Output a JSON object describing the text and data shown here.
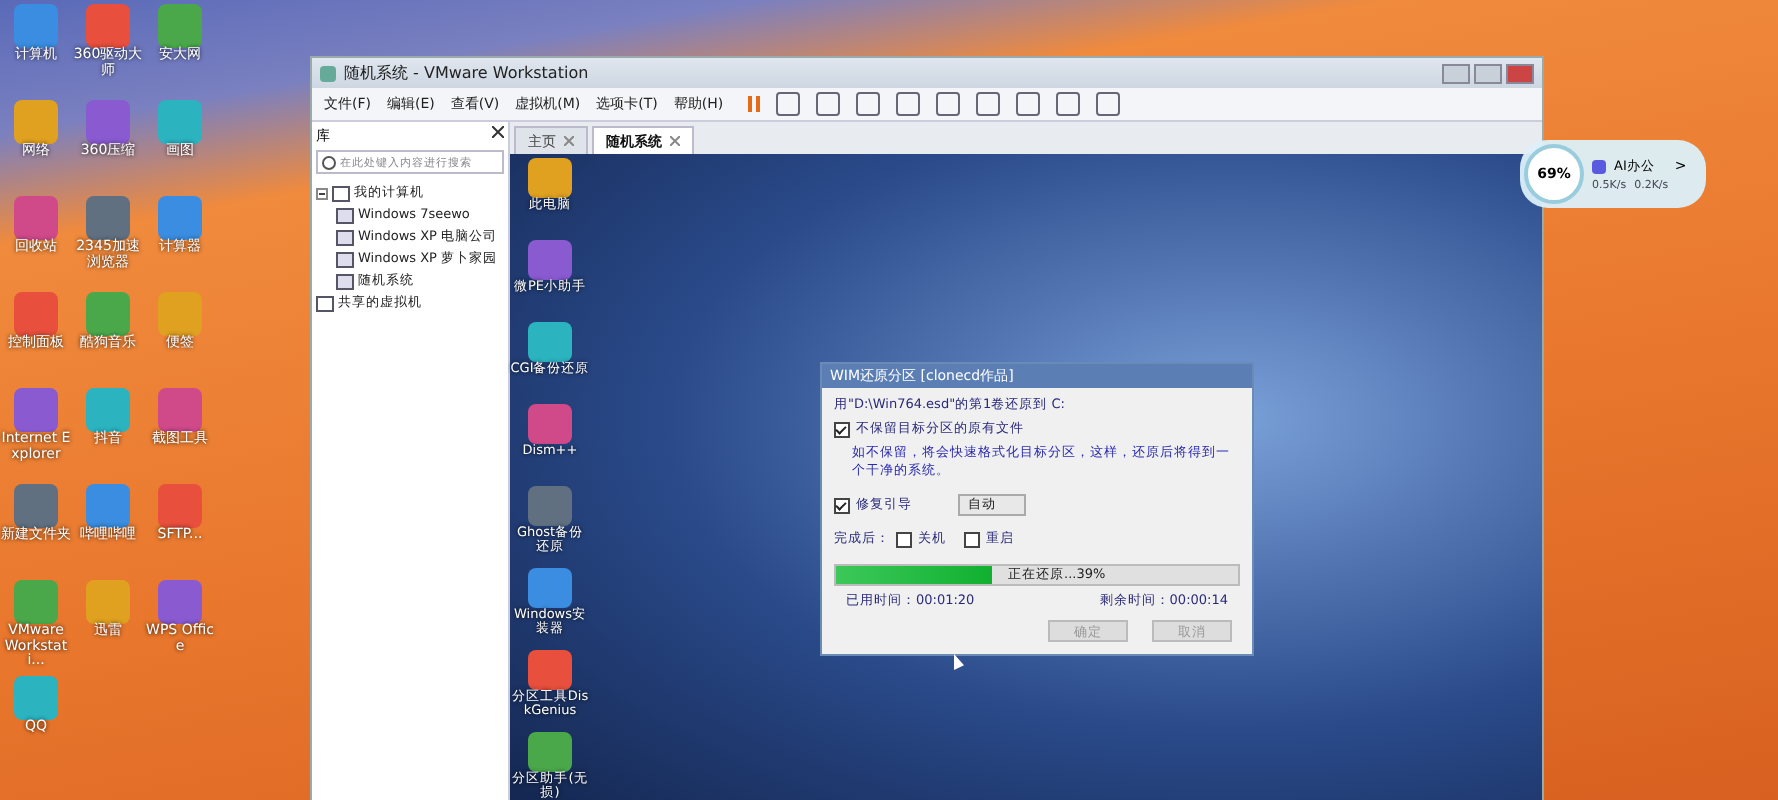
{
  "desktop_icons": [
    {
      "label": "计算机"
    },
    {
      "label": "360驱动大师"
    },
    {
      "label": "安大网"
    },
    {
      "label": "网络"
    },
    {
      "label": "360压缩"
    },
    {
      "label": "画图"
    },
    {
      "label": "回收站"
    },
    {
      "label": "2345加速浏览器"
    },
    {
      "label": "计算器"
    },
    {
      "label": "控制面板"
    },
    {
      "label": "酷狗音乐"
    },
    {
      "label": "便签"
    },
    {
      "label": "Internet Explorer"
    },
    {
      "label": "抖音"
    },
    {
      "label": "截图工具"
    },
    {
      "label": "新建文件夹"
    },
    {
      "label": "哔哩哔哩"
    },
    {
      "label": "SFTP..."
    },
    {
      "label": "VMware Workstati..."
    },
    {
      "label": "迅雷"
    },
    {
      "label": "WPS Office"
    },
    {
      "label": "QQ"
    }
  ],
  "window": {
    "title": "随机系统 - VMware Workstation"
  },
  "menu": [
    "文件(F)",
    "编辑(E)",
    "查看(V)",
    "虚拟机(M)",
    "选项卡(T)",
    "帮助(H)"
  ],
  "library": {
    "title": "库",
    "placeholder": "在此处键入内容进行搜索",
    "tree": [
      {
        "label": "我的计算机",
        "expanded": true,
        "children": [
          {
            "label": "Windows 7seewo"
          },
          {
            "label": "Windows XP 电脑公司"
          },
          {
            "label": "Windows XP 萝卜家园"
          },
          {
            "label": "随机系统"
          }
        ]
      },
      {
        "label": "共享的虚拟机"
      }
    ]
  },
  "tabs": [
    {
      "label": "主页",
      "selected": false
    },
    {
      "label": "随机系统",
      "selected": true
    }
  ],
  "vm_icons": [
    {
      "label": "此电脑"
    },
    {
      "label": "微PE小助手"
    },
    {
      "label": "CGI备份还原"
    },
    {
      "label": "Dism++"
    },
    {
      "label": "Ghost备份还原"
    },
    {
      "label": "Windows安装器"
    },
    {
      "label": "分区工具DiskGenius"
    },
    {
      "label": "分区助手(无损)"
    }
  ],
  "dialog": {
    "title": "WIM还原分区 [clonecd作品]",
    "message": "用\"D:\\Win764.esd\"的第1卷还原到 C:",
    "keep": {
      "label": "不保留目标分区的原有文件",
      "checked": true
    },
    "note": "如不保留，将会快速格式化目标分区，这样，还原后将得到一个干净的系统。",
    "repair": {
      "label": "修复引导",
      "checked": true
    },
    "mode": "自动",
    "after_label": "完成后：",
    "after": [
      {
        "label": "关机",
        "checked": false
      },
      {
        "label": "重启",
        "checked": false
      }
    ],
    "progress": {
      "level": 0.39,
      "text": "正在还原...39%"
    },
    "elapsed": "已用时间：00:01:20",
    "remaining": "剩余时间：00:00:14",
    "buttons": [
      {
        "label": "确定",
        "disabled": true
      },
      {
        "label": "取消",
        "disabled": true
      }
    ]
  },
  "widget": {
    "percent": "69%",
    "app": "AI办公",
    "chevron": ">",
    "up": "0.5K/s",
    "down": "0.2K/s"
  }
}
